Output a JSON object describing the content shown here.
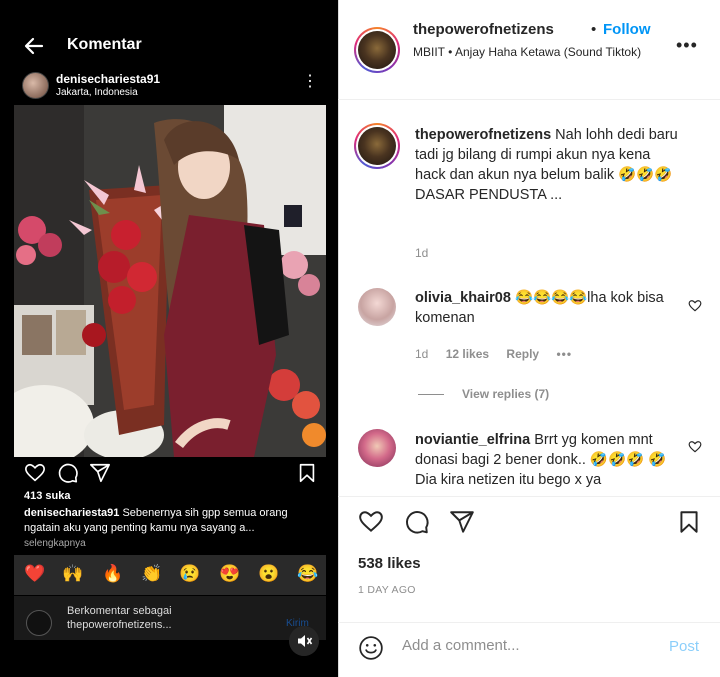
{
  "left": {
    "title": "Komentar",
    "poster_name": "denisechariesta91",
    "poster_location": "Jakarta, Indonesia",
    "likes": "413 suka",
    "caption_user": "denisechariesta91",
    "caption_text": " Sebenernya sih gpp semua orang ngatain aku yang penting kamu nya sayang a...",
    "more_label": "selengkapnya",
    "reactions": [
      "❤️",
      "🙌",
      "🔥",
      "👏",
      "😢",
      "😍",
      "😮",
      "😂"
    ],
    "comment_as": "Berkomentar sebagai",
    "comment_as_user": "thepowerofnetizens...",
    "send_label": "Kirim"
  },
  "right": {
    "username": "thepowerofnetizens",
    "dot": "•",
    "follow_label": "Follow",
    "subtitle": "MBIIT • Anjay Haha Ketawa (Sound Tiktok)",
    "comments": [
      {
        "user": "thepowerofnetizens",
        "text": " Nah lohh dedi baru tadi jg bilang di rumpi akun nya kena hack dan akun nya belum balik 🤣🤣🤣",
        "text2": "DASAR PENDUSTA ...",
        "time": "1d"
      },
      {
        "user": "olivia_khair08",
        "text": " 😂😂😂😂lha kok bisa komenan",
        "time": "1d",
        "likes": "12 likes",
        "reply": "Reply",
        "replies": "View replies (7)"
      },
      {
        "user": "noviantie_elfrina",
        "text": " Brrt yg komen mnt donasi bagi 2 bener donk.. 🤣🤣🤣 🤣 Dia kira netizen itu bego x ya"
      }
    ],
    "likes": "538 likes",
    "date": "1 DAY AGO",
    "add_comment_placeholder": "Add a comment...",
    "post_label": "Post"
  },
  "colors": {
    "accent": "#0095f6",
    "left_bg": "#000000",
    "text": "#262626",
    "muted": "#8e8e8e"
  }
}
